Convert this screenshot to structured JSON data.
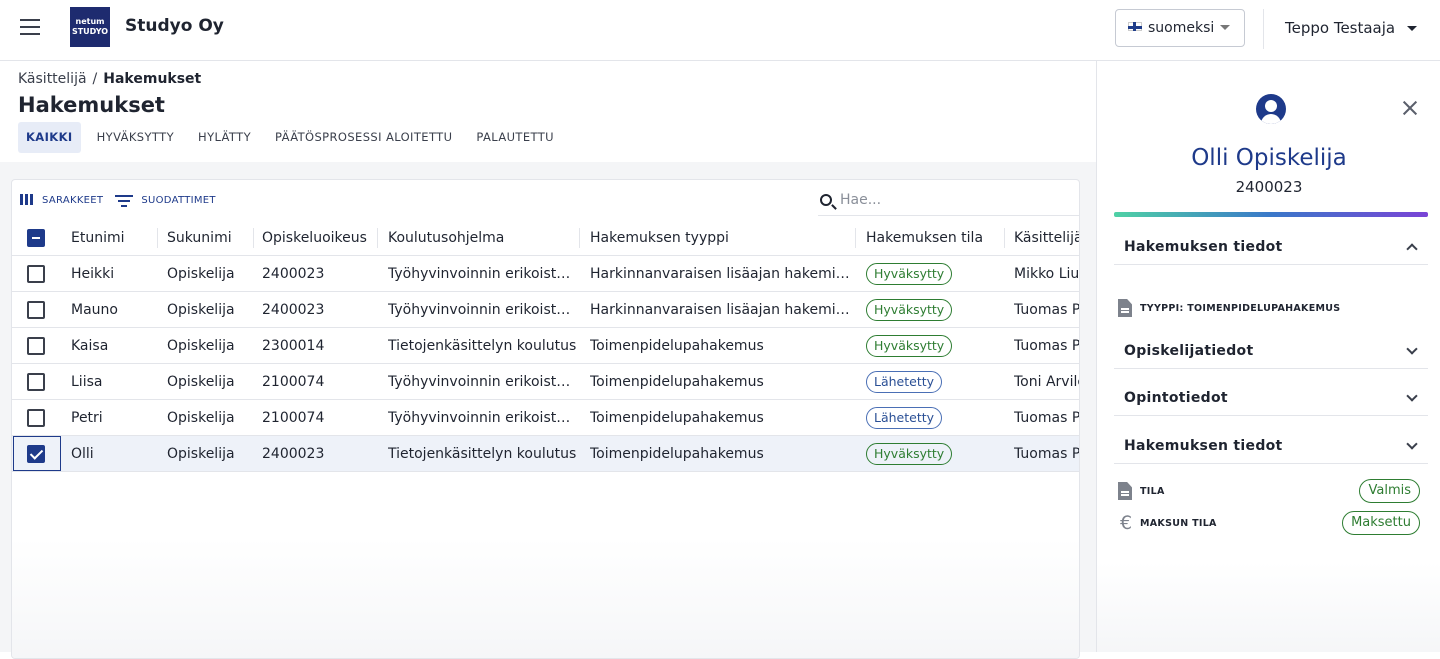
{
  "header": {
    "company": "Studyo Oy",
    "logo_text": [
      "netum",
      "STUDYO"
    ],
    "language": "suomeksi",
    "user": "Teppo Testaaja"
  },
  "breadcrumb": {
    "parent": "Käsittelijä",
    "separator": "/",
    "current": "Hakemukset"
  },
  "page_title": "Hakemukset",
  "tabs": [
    {
      "label": "KAIKKI",
      "active": true
    },
    {
      "label": "HYVÄKSYTTY",
      "active": false
    },
    {
      "label": "HYLÄTTY",
      "active": false
    },
    {
      "label": "PÄÄTÖSPROSESSI ALOITETTU",
      "active": false
    },
    {
      "label": "PALAUTETTU",
      "active": false
    }
  ],
  "toolbar": {
    "columns_label": "SARAKKEET",
    "filters_label": "SUODATTIMET",
    "search_placeholder": "Hae..."
  },
  "table": {
    "columns": [
      "Etunimi",
      "Sukunimi",
      "Opiskeluoikeus",
      "Koulutusohjelma",
      "Hakemuksen tyyppi",
      "Hakemuksen tila",
      "Käsittelijä"
    ],
    "rows": [
      {
        "first": "Heikki",
        "last": "Opiskelija",
        "right": "2400023",
        "program": "Työhyvinvoinnin erikoistu...",
        "type": "Harkinnanvaraisen lisäajan hakeminen",
        "status": "Hyväksytty",
        "handler": "Mikko Liuk",
        "checked": false
      },
      {
        "first": "Mauno",
        "last": "Opiskelija",
        "right": "2400023",
        "program": "Työhyvinvoinnin erikoistu...",
        "type": "Harkinnanvaraisen lisäajan hakeminen",
        "status": "Hyväksytty",
        "handler": "Tuomas Pu",
        "checked": false
      },
      {
        "first": "Kaisa",
        "last": "Opiskelija",
        "right": "2300014",
        "program": "Tietojenkäsittelyn koulutus",
        "type": "Toimenpidelupahakemus",
        "status": "Hyväksytty",
        "handler": "Tuomas Pu",
        "checked": false
      },
      {
        "first": "Liisa",
        "last": "Opiskelija",
        "right": "2100074",
        "program": "Työhyvinvoinnin erikoistu...",
        "type": "Toimenpidelupahakemus",
        "status": "Lähetetty",
        "handler": "Toni Arvilc",
        "checked": false
      },
      {
        "first": "Petri",
        "last": "Opiskelija",
        "right": "2100074",
        "program": "Työhyvinvoinnin erikoistu...",
        "type": "Toimenpidelupahakemus",
        "status": "Lähetetty",
        "handler": "Tuomas Pu",
        "checked": false
      },
      {
        "first": "Olli",
        "last": "Opiskelija",
        "right": "2400023",
        "program": "Tietojenkäsittelyn koulutus",
        "type": "Toimenpidelupahakemus",
        "status": "Hyväksytty",
        "handler": "Tuomas Pu",
        "checked": true
      }
    ]
  },
  "panel": {
    "name": "Olli Opiskelija",
    "id": "2400023",
    "sections": [
      {
        "label": "Hakemuksen tiedot",
        "expanded": true
      },
      {
        "label": "Opiskelijatiedot",
        "expanded": false
      },
      {
        "label": "Opintotiedot",
        "expanded": false
      },
      {
        "label": "Hakemuksen tiedot",
        "expanded": false
      }
    ],
    "type_label": "TYYPPI: TOIMENPIDELUPAHAKEMUS",
    "tila_label": "TILA",
    "tila_value": "Valmis",
    "payment_label": "MAKSUN TILA",
    "payment_value": "Maksettu"
  }
}
